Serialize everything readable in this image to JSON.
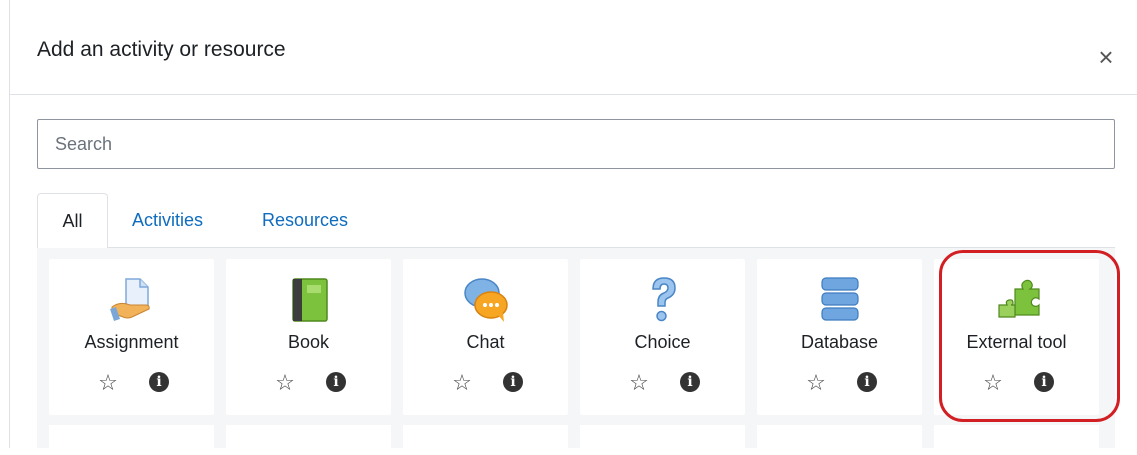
{
  "modal": {
    "title": "Add an activity or resource",
    "close_label": "×"
  },
  "search": {
    "placeholder": "Search",
    "value": ""
  },
  "tabs": [
    {
      "label": "All",
      "active": true
    },
    {
      "label": "Activities",
      "active": false
    },
    {
      "label": "Resources",
      "active": false
    }
  ],
  "items": [
    {
      "label": "Assignment",
      "icon": "assignment-icon"
    },
    {
      "label": "Book",
      "icon": "book-icon"
    },
    {
      "label": "Chat",
      "icon": "chat-icon"
    },
    {
      "label": "Choice",
      "icon": "choice-icon"
    },
    {
      "label": "Database",
      "icon": "database-icon"
    },
    {
      "label": "External tool",
      "icon": "external-tool-icon",
      "highlighted": true
    }
  ],
  "item_actions": {
    "star_glyph": "☆",
    "info_glyph": "i"
  },
  "colors": {
    "link": "#0f6cbf",
    "highlight": "#d21f23",
    "grid_background": "#f5f6f7"
  }
}
